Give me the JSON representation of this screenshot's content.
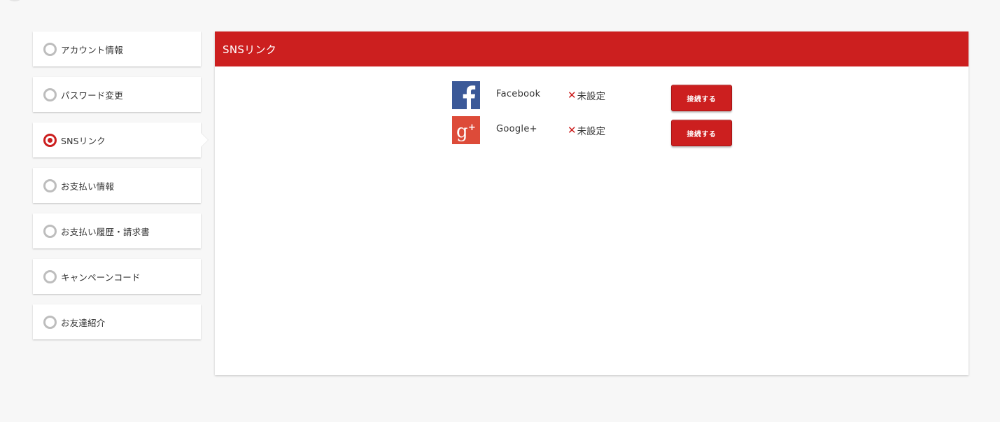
{
  "sidebar": {
    "items": [
      {
        "label": "アカウント情報",
        "active": false
      },
      {
        "label": "パスワード変更",
        "active": false
      },
      {
        "label": "SNSリンク",
        "active": true
      },
      {
        "label": "お支払い情報",
        "active": false
      },
      {
        "label": "お支払い履歴・請求書",
        "active": false
      },
      {
        "label": "キャンペーンコード",
        "active": false
      },
      {
        "label": "お友達紹介",
        "active": false
      }
    ]
  },
  "panel": {
    "title": "SNSリンク",
    "accounts": [
      {
        "service": "Facebook",
        "icon": "facebook-icon",
        "status_mark": "✕",
        "status": "未設定",
        "button_label": "接続する",
        "color": "#3b5998"
      },
      {
        "service": "Google+",
        "icon": "google-plus-icon",
        "status_mark": "✕",
        "status": "未設定",
        "button_label": "接続する",
        "color": "#dd4b39"
      }
    ]
  },
  "colors": {
    "accent": "#cc1f1f",
    "background": "#f7f7f7"
  }
}
